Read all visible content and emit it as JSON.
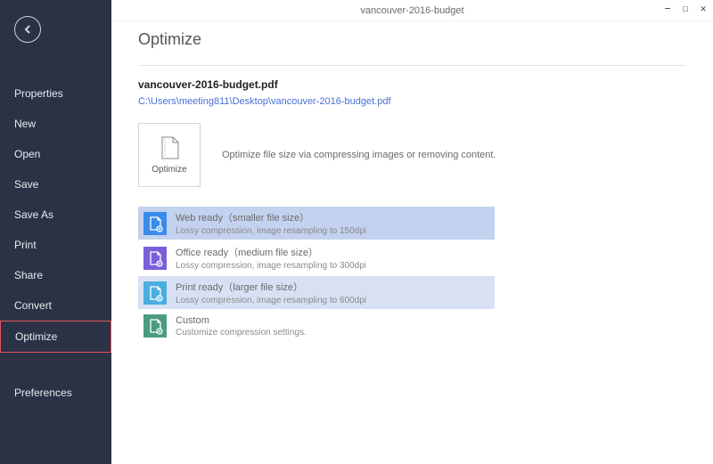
{
  "window": {
    "title": "vancouver-2016-budget"
  },
  "sidebar": {
    "items": [
      {
        "label": "Properties"
      },
      {
        "label": "New"
      },
      {
        "label": "Open"
      },
      {
        "label": "Save"
      },
      {
        "label": "Save As"
      },
      {
        "label": "Print"
      },
      {
        "label": "Share"
      },
      {
        "label": "Convert"
      },
      {
        "label": "Optimize"
      },
      {
        "label": "Preferences"
      }
    ]
  },
  "page": {
    "title": "Optimize",
    "filename": "vancouver-2016-budget.pdf",
    "filepath": "C:\\Users\\meeting811\\Desktop\\vancouver-2016-budget.pdf",
    "tile_label": "Optimize",
    "description": "Optimize file size via compressing images or removing content."
  },
  "options": [
    {
      "title": "Web ready（smaller file size）",
      "sub": "Lossy compression, image resampling to 150dpi",
      "icon_color": "#3b8bea",
      "hl": "sel-blue"
    },
    {
      "title": "Office ready（medium file size）",
      "sub": "Lossy compression, image resampling to 300dpi",
      "icon_color": "#7a5fd9",
      "hl": ""
    },
    {
      "title": "Print ready（larger file size）",
      "sub": "Lossy compression, image resampling to 600dpi",
      "icon_color": "#4aaee0",
      "hl": "sel-light"
    },
    {
      "title": "Custom",
      "sub": "Customize compression settings.",
      "icon_color": "#4a9c7f",
      "hl": ""
    }
  ]
}
